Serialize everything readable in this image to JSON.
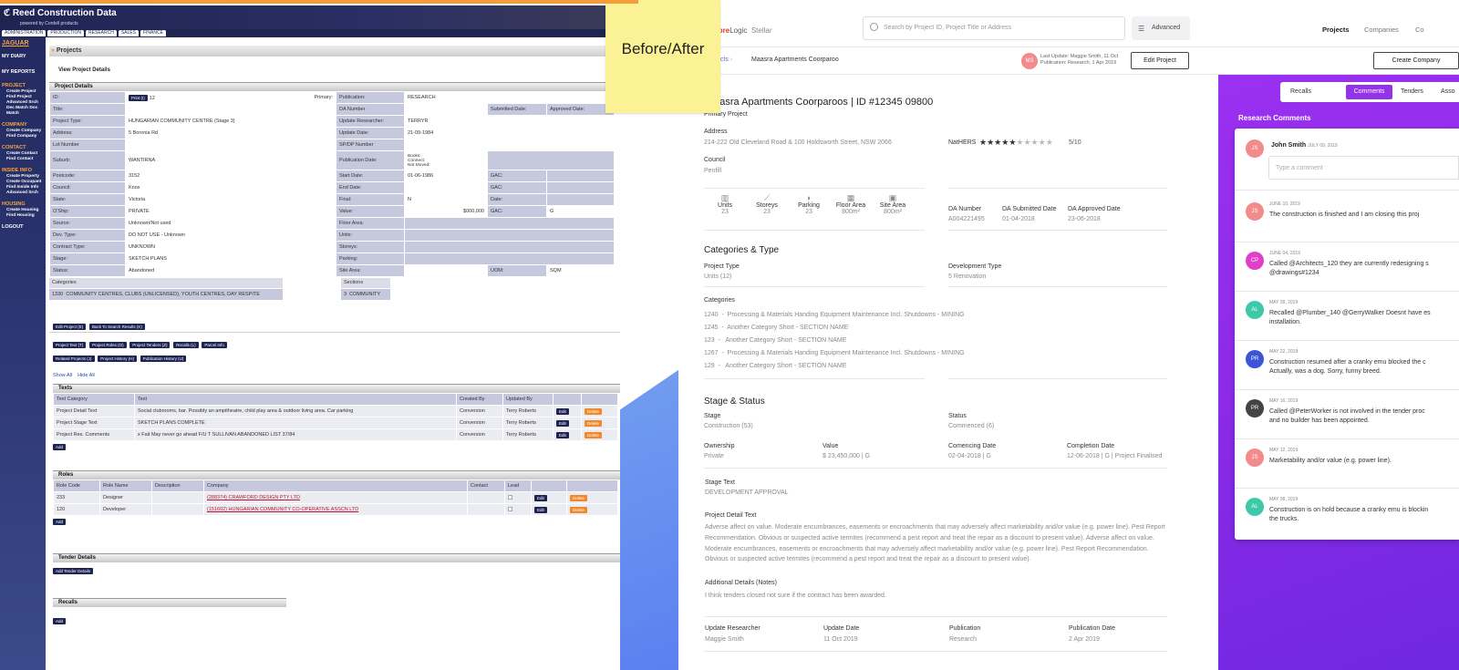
{
  "label": "Before/After",
  "old": {
    "brand": "Reed Construction Data",
    "brand_sub": "powered by Cordell products",
    "tabs": [
      "ADMINISTRATION",
      "PRODUCTION",
      "RESEARCH",
      "SALES",
      "FINANCE"
    ],
    "user": "JAGUAR",
    "sidebar": {
      "my_diary": "MY DIARY",
      "my_reports": "MY REPORTS",
      "project": "PROJECT",
      "project_items": [
        "Create Project",
        "Find Project",
        "Advanced Srch",
        "Dec Match Doc Match"
      ],
      "company": "COMPANY",
      "company_items": [
        "Create Company",
        "Find Company"
      ],
      "contact": "CONTACT",
      "contact_items": [
        "Create Contact",
        "Find Contact"
      ],
      "inside": "INSIDE INFO",
      "inside_items": [
        "Create Property",
        "Create Occupant",
        "Find Inside Info",
        "Advanced Srch"
      ],
      "housing": "HOUSING",
      "housing_items": [
        "Create Housing",
        "Find Housing"
      ],
      "logout": "LOGOUT"
    },
    "page_title": "Projects",
    "view_title": "View Project Details",
    "details_header": "Project Details",
    "details": {
      "id_label": "ID:",
      "print": "Print (I)",
      "id_suffix": "12",
      "primary": "Primary:",
      "publication_label": "Publication:",
      "publication": "RESEARCH",
      "title_label": "Title:",
      "da_label": "DA Number",
      "submitted_label": "Submitted Date:",
      "approved_label": "Approved Date:",
      "type_label": "Project Type:",
      "type": "HUNGARIAN COMMUNITY CENTRE (Stage 3)",
      "upd_res_label": "Update Researcher:",
      "upd_res": "TERRYR",
      "address_label": "Address:",
      "address": "5 Boronia Rd",
      "update_date_label": "Update Date:",
      "update_date": "21-09-1984",
      "lot_label": "Lot Number",
      "spdp_label": "SP/DP Number",
      "suburb_label": "Suburb:",
      "suburb": "WANTIRNA",
      "pubdate_label": "Publication Date:",
      "pubdate": "Books:\nConnect:\nNot Moved:",
      "postcode_label": "Postcode:",
      "postcode": "3152",
      "start_label": "Start Date:",
      "start": "01-06-1986",
      "gac": "GAC:",
      "council_label": "Council:",
      "council": "Knox",
      "end_label": "End Date:",
      "state_label": "State:",
      "state": "Victoria",
      "final_label": "Final:",
      "final": "N",
      "date_label": "Date:",
      "oship_label": "O'Ship:",
      "oship": "PRIVATE",
      "value_label": "Value:",
      "value": "$000,000",
      "gac_val": "G",
      "source_label": "Source:",
      "source": "Unknown/Not used",
      "floor_label": "Floor Area:",
      "dev_label": "Dev. Type:",
      "dev": "DO NOT USE - Unknown",
      "units_label": "Units:",
      "contract_label": "Contract Type:",
      "contract": "UNKNOWN",
      "storeys_label": "Storeys:",
      "stage_label": "Stage:",
      "stage": "SKETCH PLANS",
      "parking_label": "Parking:",
      "status_label": "Status:",
      "status": "Abandoned",
      "site_label": "Site Area:",
      "uom_label": "UOM:",
      "uom": "SQM",
      "categories_label": "Categories",
      "cat_code": "1330",
      "cat_name": "COMMUNITY CENTRES, CLUBS (UNLICENSED), YOUTH CENTRES, DAY RESPITE",
      "sections_label": "Sections",
      "sec_code": "3",
      "sec_name": "COMMUNITY"
    },
    "buttons1": [
      "Edit Project (E)",
      "Back To Search Results (K)"
    ],
    "buttons2": [
      "Project Text (T)",
      "Project Roles (O)",
      "Project Tenders (Z)",
      "Recalls (L)",
      "Parcel Info"
    ],
    "buttons3": [
      "Related Projects (J)",
      "Project History (H)",
      "Publication History (U)"
    ],
    "show_all": "Show All",
    "hide_all": "Hide All",
    "texts_header": "Texts",
    "texts_cols": [
      "Text Category",
      "Text",
      "Created By",
      "Updated By"
    ],
    "texts_rows": [
      [
        "Project Detail Text",
        "Social clubrooms, bar. Possibly an ampitheatre, child play area & outdoor living area. Car parking",
        "Conversion",
        "Terry Roberts"
      ],
      [
        "Project Stage Text",
        "SKETCH PLANS COMPLETE",
        "Conversion",
        "Terry Roberts"
      ],
      [
        "Project Res. Comments",
        "x Fait May never go ahead F/U T SULLIVAN ABANDONED LIST 37/84",
        "Conversion",
        "Terry Roberts"
      ]
    ],
    "edit": "Edit",
    "delete": "Delete",
    "add": "Add",
    "roles_header": "Roles",
    "roles_cols": [
      "Role Code",
      "Role Name",
      "Description",
      "Company",
      "Contact",
      "Lead"
    ],
    "roles_rows": [
      [
        "233",
        "Designer",
        "",
        "(288374) CRAWFORD DESIGN PTY LTD"
      ],
      [
        "120",
        "Developer",
        "",
        "(151602) HUNGARIAN COMMUNITY CO-OPERATIVE ASSCN LTD"
      ]
    ],
    "tender_header": "Tender Details",
    "add_tender": "Add Tender Details",
    "recalls_header": "Recalls"
  },
  "new": {
    "logo_a": "Core",
    "logo_b": "Logic",
    "logo_c": "Stellar",
    "search_placeholder": "Search by Project ID, Project Title or Address",
    "advanced": "Advanced",
    "nav": [
      "Projects",
      "Companies",
      "Co"
    ],
    "crumb_a": "ects",
    "crumb_b": "Maasra Apartments Coorparoo",
    "avatar": "MS",
    "last_update": "Last Update: Maggie Smith, 11 Oct",
    "publication_line": "Publication: Research, 1 Apr 2019",
    "edit_project": "Edit Project",
    "create_company": "Create Company",
    "title": "Maasra Apartments Coorparoos | ID #12345 09800",
    "primary": "Primary Project",
    "address_label": "Address",
    "address": "214-222 Old Cleveland Road & 100 Holdsworth Street, NSW 2066",
    "nathers_label": "NatHERS",
    "nathers_score": "5/10",
    "nathers_value": 5,
    "nathers_max": 10,
    "council_label": "Council",
    "council": "Penfill",
    "stats": [
      {
        "icon": "building-icon",
        "glyph": "▥",
        "label": "Units",
        "value": "23"
      },
      {
        "icon": "stairs-icon",
        "glyph": "⟋",
        "label": "Storeys",
        "value": "23"
      },
      {
        "icon": "car-icon",
        "glyph": "◗",
        "label": "Parking",
        "value": "23"
      },
      {
        "icon": "floor-plan-icon",
        "glyph": "▦",
        "label": "Floor Area",
        "value": "800m²"
      },
      {
        "icon": "site-area-icon",
        "glyph": "▣",
        "label": "Site Area",
        "value": "800m²"
      }
    ],
    "da_number_label": "DA Number",
    "da_number": "A004221495",
    "da_sub_label": "DA Submitted Date",
    "da_sub": "01-04-2018",
    "da_app_label": "DA Approved Date",
    "da_app": "23-06-2018",
    "cat_title": "Categories & Type",
    "ptype_label": "Project Type",
    "ptype": "Units (12)",
    "dtype_label": "Development Type",
    "dtype": "5 Renovation",
    "categories_label": "Categories",
    "categories": [
      "1240  -  Processing & Materials Handing Equipment Maintenance Incl. Shutdowns - MINING",
      "1245  -  Another Category Short - SECTION NAME",
      "123  -   Another Category Short - SECTION NAME",
      "1267  -  Processing & Materials Handing Equipment Maintenance Incl. Shutdowns - MINING",
      "129  -   Another Category Short - SECTION NAME"
    ],
    "stage_title": "Stage & Status",
    "stage_label": "Stage",
    "stage": "Construction (53)",
    "status_label": "Status",
    "status": "Commenced (6)",
    "own_label": "Ownership",
    "own": "Private",
    "value_label": "Value",
    "value": "$ 23,450,000 | G",
    "comm_label": "Comencing Date",
    "comm": "02-04-2018 | G",
    "comp_label": "Completion Date",
    "comp": "12-06-2018 | G | Project Finalised",
    "stage_text_label": "Stage Text",
    "stage_text": "DEVELOPMENT APPROVAL",
    "pdt_label": "Project Detail Text",
    "pdt": "Adverse affect on value. Moderate encumbrances, easements or encroachments that may adversely affect  marketability and/or value (e.g. power line). Pest Report Recommendation. Obvious or suspected active termites (recommend a pest report and treat the repair as a discount to present value). Adverse affect on value. Moderate encumbrances, easements or encroachments that may adversely affect  marketability and/or value (e.g. power line). Pest Report Recommendation. Obvious or suspected active termites (recommend a pest report and treat the repair as a discount to present value).",
    "notes_label": "Additional Details (Notes)",
    "notes": "I think tenders closed not sure if the contract has been awarded.",
    "ur_label": "Update Researcher",
    "ur": "Maggie Smith",
    "ud_label": "Update Date",
    "ud": "11 Oct 2019",
    "pub_label": "Publication",
    "pub": "Research",
    "pd_label": "Publication Date",
    "pd": "2 Apr 2019",
    "tabs": [
      "Recalls",
      "Comments",
      "Tenders",
      "Asso"
    ],
    "rc_title": "Research Comments",
    "composer_avatar": "JS",
    "composer_name": "John Smith",
    "composer_date": "JULY 09, 2019",
    "composer_placeholder": "Type a comment",
    "comments": [
      {
        "av": "JS",
        "color": "#f28b8b",
        "date": "JUNE 10, 2019",
        "text": "The construction is finished and I am closing this proj"
      },
      {
        "av": "CP",
        "color": "#e040c8",
        "date": "JUNE 04, 2019",
        "text": "Called @Architects_120 they are currently redesigning s\n@drawings#1234"
      },
      {
        "av": "AL",
        "color": "#3fc8a8",
        "date": "MAY 28, 2019",
        "text": "Recalled @Plumber_140 @GerryWalker Doesnt have es\ninstallation."
      },
      {
        "av": "PR",
        "color": "#3a55d8",
        "date": "MAY 22, 2019",
        "text": "Construction resumed after a cranky emu blocked the c\nActually, was a dog. Sorry, funny breed."
      },
      {
        "av": "PR",
        "color": "#444444",
        "date": "MAY 16, 2019",
        "text": "Called @PeterWorker is not involved in the tender proc\nand no builder has been appointed."
      },
      {
        "av": "JS",
        "color": "#f28b8b",
        "date": "MAY 12, 2019",
        "text": "Marketability and/or value (e.g. power line)."
      },
      {
        "av": "AL",
        "color": "#3fc8a8",
        "date": "MAY 08, 2019",
        "text": "Construction is on hold because a cranky emu is blockin\nthe trucks."
      }
    ]
  }
}
